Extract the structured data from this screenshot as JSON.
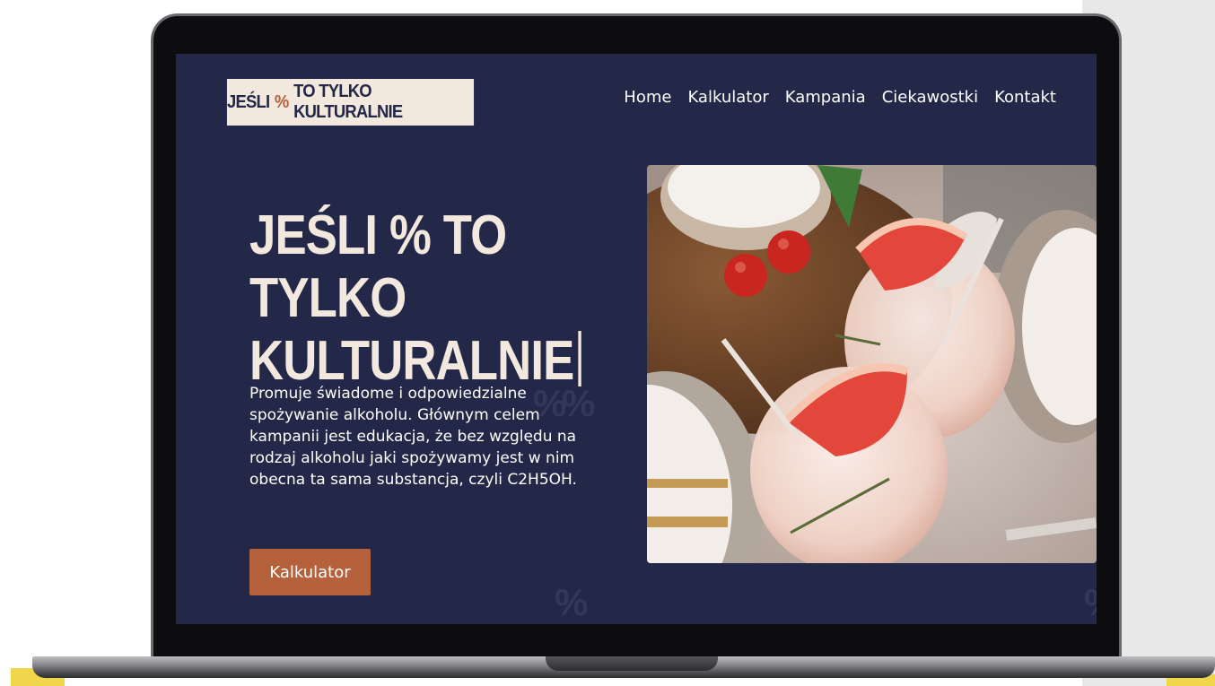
{
  "site": {
    "logo": {
      "prefix": "JEŚLI",
      "symbol": "%",
      "suffix": "TO TYLKO KULTURALNIE"
    },
    "nav": [
      {
        "label": "Home"
      },
      {
        "label": "Kalkulator"
      },
      {
        "label": "Kampania"
      },
      {
        "label": "Ciekawostki"
      },
      {
        "label": "Kontakt"
      }
    ]
  },
  "hero": {
    "title_line1": "JEŚLI % TO TYLKO",
    "title_line2": "KULTURALNIE",
    "description": "Promuje świadome i odpowiedzialne spożywanie alkoholu. Głównym celem kampanii jest edukacja, że bez względu na rodzaj alkoholu jaki spożywamy jest w nim obecna ta sama substancja, czyli C2H5OH.",
    "button_label": "Kalkulator",
    "decor_symbols": [
      "%",
      "%",
      "%",
      "%"
    ]
  },
  "colors": {
    "screen_bg": "#232849",
    "accent": "#b5613b",
    "cream": "#f2e8de",
    "panel_grey": "#e7e8e7",
    "yellow": "#f0d64a"
  }
}
